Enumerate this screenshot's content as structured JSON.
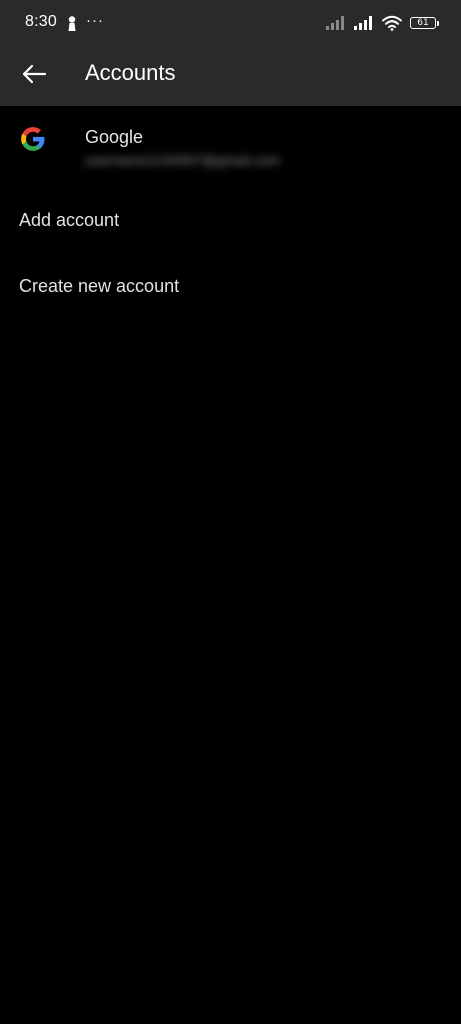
{
  "status_bar": {
    "time": "8:30",
    "more_indicator": "···",
    "battery_level": "61"
  },
  "app_bar": {
    "title": "Accounts",
    "back_icon": "arrow-left-icon"
  },
  "accounts": [
    {
      "provider": "Google",
      "icon": "google-icon",
      "email": "username1234567@gmail.com"
    }
  ],
  "menu": {
    "add_account": "Add account",
    "create_new_account": "Create new account"
  },
  "colors": {
    "background": "#000000",
    "app_bar": "#2a2a2a",
    "text_primary": "#e6e6e6",
    "google_blue": "#4285F4",
    "google_red": "#EA4335",
    "google_yellow": "#FBBC05",
    "google_green": "#34A853"
  }
}
